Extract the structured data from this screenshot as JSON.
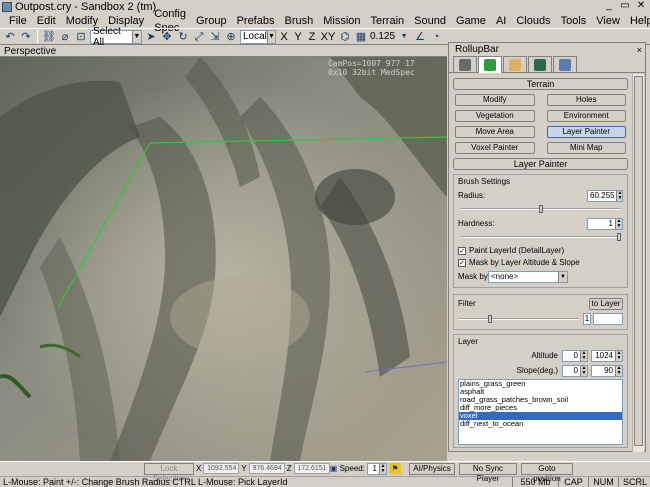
{
  "window": {
    "title": "Outpost.cry - Sandbox 2 (tm)"
  },
  "menu": [
    "File",
    "Edit",
    "Modify",
    "Display",
    "Config Spec",
    "Group",
    "Prefabs",
    "Brush",
    "Mission",
    "Terrain",
    "Sound",
    "Game",
    "AI",
    "Clouds",
    "Tools",
    "View",
    "Help"
  ],
  "toolbar": {
    "select_mode": "Select All",
    "coord_system": "Local",
    "axes": [
      "X",
      "Y",
      "Z",
      "XY"
    ],
    "grid_size": "0.125"
  },
  "viewport": {
    "label": "Perspective",
    "camera_text": "CamPos=1007 977 17\n0x10 32bit MedSpec"
  },
  "rollup": {
    "title": "RollupBar",
    "close": "×",
    "terrain": {
      "header": "Terrain",
      "buttons": [
        {
          "label": "Modify",
          "active": false
        },
        {
          "label": "Holes",
          "active": false
        },
        {
          "label": "Vegetation",
          "active": false
        },
        {
          "label": "Environment",
          "active": false
        },
        {
          "label": "Move Area",
          "active": false
        },
        {
          "label": "Layer Painter",
          "active": true
        },
        {
          "label": "Voxel Painter",
          "active": false
        },
        {
          "label": "Mini Map",
          "active": false
        }
      ]
    },
    "layer_painter": {
      "header": "Layer Painter",
      "brush_settings": "Brush Settings",
      "radius_label": "Radius:",
      "radius_value": "60.255",
      "radius_fraction": 0.5,
      "hardness_label": "Hardness:",
      "hardness_value": "1",
      "hardness_fraction": 1.0,
      "paint_layer_label": "Paint LayerId (DetailLayer)",
      "paint_layer_checked": true,
      "mask_label": "Mask by Layer Altitude & Slope",
      "mask_checked": true,
      "mask_by_label": "Mask by",
      "mask_by_value": "<none>",
      "filter_label": "Filter",
      "to_layer_label": "to Layer",
      "filter_value": "1",
      "layer_label": "Layer",
      "altitude_label": "Altitude",
      "altitude_min": "0",
      "altitude_max": "1024",
      "slope_label": "Slope(deg.)",
      "slope_min": "0",
      "slope_max": "90",
      "layers": [
        {
          "name": "plains_grass_green",
          "selected": false
        },
        {
          "name": "asphalt",
          "selected": false
        },
        {
          "name": "road_grass_patches_brown_soil",
          "selected": false
        },
        {
          "name": "diff_more_pieces",
          "selected": false
        },
        {
          "name": "voxel",
          "selected": true
        },
        {
          "name": "diff_next_to_ocean",
          "selected": false
        }
      ]
    }
  },
  "bottom_toolbar": {
    "lock_selection": "Lock Selection",
    "x_label": "X",
    "x_value": "1092.554",
    "y_label": "Y",
    "y_value": "976.4694",
    "z_label": "Z",
    "z_value": "172.6151",
    "speed_label": "Speed:",
    "speed_value": "1",
    "ai_physics": "AI/Physics",
    "no_sync": "No Sync Player",
    "goto_position": "Goto position"
  },
  "status": {
    "hint": "L-Mouse: Paint  +/-: Change Brush Radius   CTRL L-Mouse: Pick LayerId",
    "memory": "550 Mb",
    "cap": "CAP",
    "num": "NUM",
    "scrl": "SCRL"
  },
  "colors": {
    "accent": "#316ac5",
    "active_button": "#c8d6ec",
    "selection_line": "#32c832"
  }
}
